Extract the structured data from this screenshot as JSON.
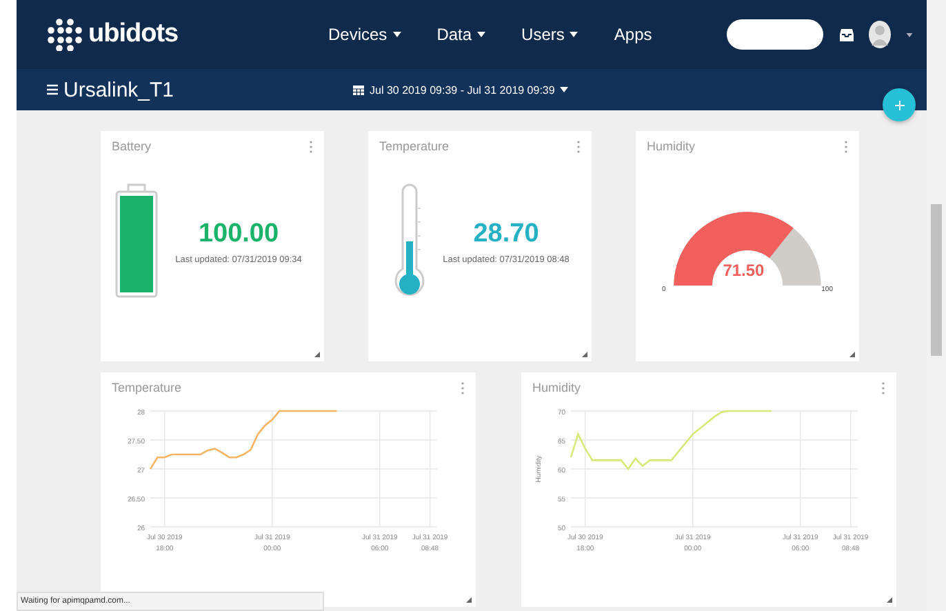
{
  "nav": {
    "logo": "ubidots",
    "items": [
      {
        "label": "Devices",
        "has_menu": true
      },
      {
        "label": "Data",
        "has_menu": true
      },
      {
        "label": "Users",
        "has_menu": true
      },
      {
        "label": "Apps",
        "has_menu": false
      }
    ]
  },
  "dashboard": {
    "title": "Ursalink_T1",
    "date_range": "Jul 30 2019 09:39 - Jul 31 2019 09:39"
  },
  "widgets": [
    {
      "kind": "battery",
      "title": "Battery",
      "value": "100.00",
      "color": "#1bb36a",
      "level": 1,
      "updated": "Last updated: 07/31/2019 09:34"
    },
    {
      "kind": "thermometer",
      "title": "Temperature",
      "value": "28.70",
      "color": "#25b0c4",
      "updated": "Last updated: 07/31/2019 08:48"
    },
    {
      "kind": "gauge",
      "title": "Humidity",
      "value": "71.50",
      "color": "#f2605e",
      "level": 0.715,
      "min": "0",
      "max": "100"
    }
  ],
  "charts": [
    {
      "title": "Temperature",
      "chart_data": {
        "type": "line",
        "grid": true,
        "categories": [
          null,
          null,
          "Jul 30 2019 18:00",
          null,
          null,
          null,
          null,
          null,
          null,
          null,
          null,
          null,
          null,
          null,
          null,
          null,
          null,
          "Jul 31 2019 00:00",
          null,
          null,
          null,
          null,
          null,
          null,
          null,
          null,
          null,
          null,
          null,
          null,
          null,
          null,
          "Jul 31 2019 06:00",
          null,
          null,
          null,
          null,
          null,
          null,
          "Jul 31 2019 08:48"
        ],
        "series": [
          {
            "color": "#f5b565",
            "values": [
              27,
              27.2,
              27.2,
              27.25,
              27.25,
              27.25,
              27.25,
              27.25,
              27.32,
              27.35,
              27.28,
              27.2,
              27.2,
              27.25,
              27.33,
              27.6,
              27.75,
              27.85,
              28,
              28,
              28,
              28,
              28,
              28,
              28,
              28,
              28,
              null,
              null,
              null,
              null,
              null,
              null,
              null,
              null,
              null,
              null,
              null,
              null,
              null
            ]
          }
        ],
        "ylim": [
          26,
          28
        ],
        "yticks": [
          26,
          {
            "value": 26.5,
            "label": "26.50"
          },
          27,
          {
            "value": 27.5,
            "label": "27.50"
          },
          28
        ]
      }
    },
    {
      "title": "Humidity",
      "chart_data": {
        "type": "line",
        "grid": true,
        "ylabel": "Humidity",
        "categories": [
          null,
          null,
          "Jul 30 2019 18:00",
          null,
          null,
          null,
          null,
          null,
          null,
          null,
          null,
          null,
          null,
          null,
          null,
          null,
          null,
          "Jul 31 2019 00:00",
          null,
          null,
          null,
          null,
          null,
          null,
          null,
          null,
          null,
          null,
          null,
          null,
          null,
          null,
          "Jul 31 2019 06:00",
          null,
          null,
          null,
          null,
          null,
          null,
          "Jul 31 2019 08:48"
        ],
        "series": [
          {
            "color": "#d9e87a",
            "values": [
              62,
              66,
              63.5,
              61.5,
              61.5,
              61.5,
              61.5,
              61.5,
              60,
              61.8,
              60.5,
              61.5,
              61.5,
              61.5,
              61.5,
              63,
              64.5,
              66,
              67,
              68,
              69,
              69.8,
              70,
              70,
              70,
              70,
              70,
              70,
              70,
              null,
              null,
              null,
              null,
              null,
              null,
              null,
              null,
              null,
              null,
              null
            ]
          }
        ],
        "ylim": [
          50,
          70
        ],
        "yticks": [
          50,
          55,
          60,
          65,
          70
        ]
      }
    }
  ],
  "status_bar": "Waiting for apimqpamd.com..."
}
